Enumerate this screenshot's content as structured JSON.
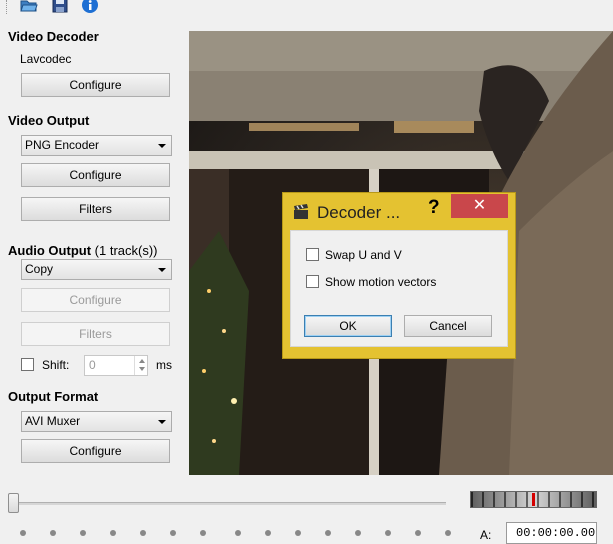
{
  "toolbar": {
    "icons": [
      "open-folder-icon",
      "save-icon",
      "info-icon"
    ]
  },
  "video_decoder": {
    "title": "Video Decoder",
    "codec": "Lavcodec",
    "configure_label": "Configure"
  },
  "video_output": {
    "title": "Video Output",
    "selected": "PNG Encoder",
    "configure_label": "Configure",
    "filters_label": "Filters"
  },
  "audio_output": {
    "title": "Audio Output",
    "tracks": "(1 track(s))",
    "selected": "Copy",
    "configure_label": "Configure",
    "filters_label": "Filters",
    "shift_label": "Shift:",
    "shift_value": "0",
    "shift_unit": "ms",
    "shift_checked": false
  },
  "output_format": {
    "title": "Output Format",
    "selected": "AVI Muxer",
    "configure_label": "Configure"
  },
  "dialog": {
    "title": "Decoder ...",
    "help_label": "?",
    "close_label": "✕",
    "options": [
      {
        "label": "Swap U and V",
        "checked": false
      },
      {
        "label": "Show motion vectors",
        "checked": false
      }
    ],
    "ok_label": "OK",
    "cancel_label": "Cancel",
    "title_bar_color": "#e4c231",
    "close_color": "#c9474b"
  },
  "timeline": {
    "a_label": "A:",
    "time_value": "00:00:00.00"
  }
}
